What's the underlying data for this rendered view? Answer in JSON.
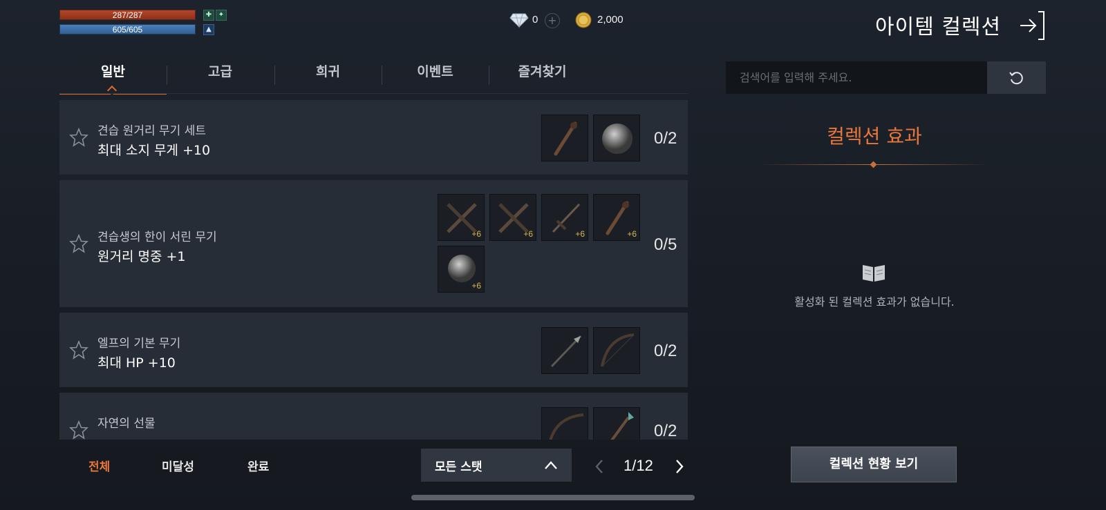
{
  "player": {
    "hp": "287/287",
    "mp": "605/605"
  },
  "currency": {
    "diamond": "0",
    "gold": "2,000"
  },
  "window_title": "아이템 컬렉션",
  "tabs": [
    {
      "label": "일반",
      "active": true
    },
    {
      "label": "고급"
    },
    {
      "label": "희귀"
    },
    {
      "label": "이벤트"
    },
    {
      "label": "즐겨찾기"
    }
  ],
  "search": {
    "placeholder": "검색어를 입력해 주세요."
  },
  "collections": [
    {
      "name": "견습 원거리 무기 세트",
      "effect": "최대 소지 무게 +10",
      "progress": "0/2",
      "items": [
        {
          "icon": "staff-icon",
          "plus": ""
        },
        {
          "icon": "orb-icon",
          "plus": ""
        }
      ]
    },
    {
      "name": "견습생의 한이 서린 무기",
      "effect": "원거리 명중 +1",
      "progress": "0/5",
      "items": [
        {
          "icon": "crossed-daggers-icon",
          "plus": "+6"
        },
        {
          "icon": "crossed-daggers-icon",
          "plus": "+6"
        },
        {
          "icon": "sword-icon",
          "plus": "+6"
        },
        {
          "icon": "staff-icon",
          "plus": "+6"
        },
        {
          "icon": "orb-icon",
          "plus": "+6"
        }
      ]
    },
    {
      "name": "엘프의 기본 무기",
      "effect": "최대 HP +10",
      "progress": "0/2",
      "items": [
        {
          "icon": "spear-icon",
          "plus": ""
        },
        {
          "icon": "bow-icon",
          "plus": ""
        }
      ]
    },
    {
      "name": "자연의 선물",
      "effect": "",
      "progress": "0/2",
      "items": [
        {
          "icon": "bow-icon",
          "plus": ""
        },
        {
          "icon": "wand-icon",
          "plus": ""
        }
      ]
    }
  ],
  "effects_panel": {
    "title": "컬렉션 효과",
    "empty_text": "활성화 된 컬렉션 효과가 없습니다."
  },
  "filters": [
    {
      "label": "전체",
      "active": true
    },
    {
      "label": "미달성"
    },
    {
      "label": "완료"
    }
  ],
  "stat_select": {
    "value": "모든 스탯"
  },
  "pager": {
    "text": "1/12"
  },
  "status_button": {
    "label": "컬렉션 현황 보기"
  },
  "colors": {
    "accent": "#e9763a",
    "row_bg": "#272d37",
    "hp": "#b4472a",
    "mp": "#4a7fb8"
  }
}
